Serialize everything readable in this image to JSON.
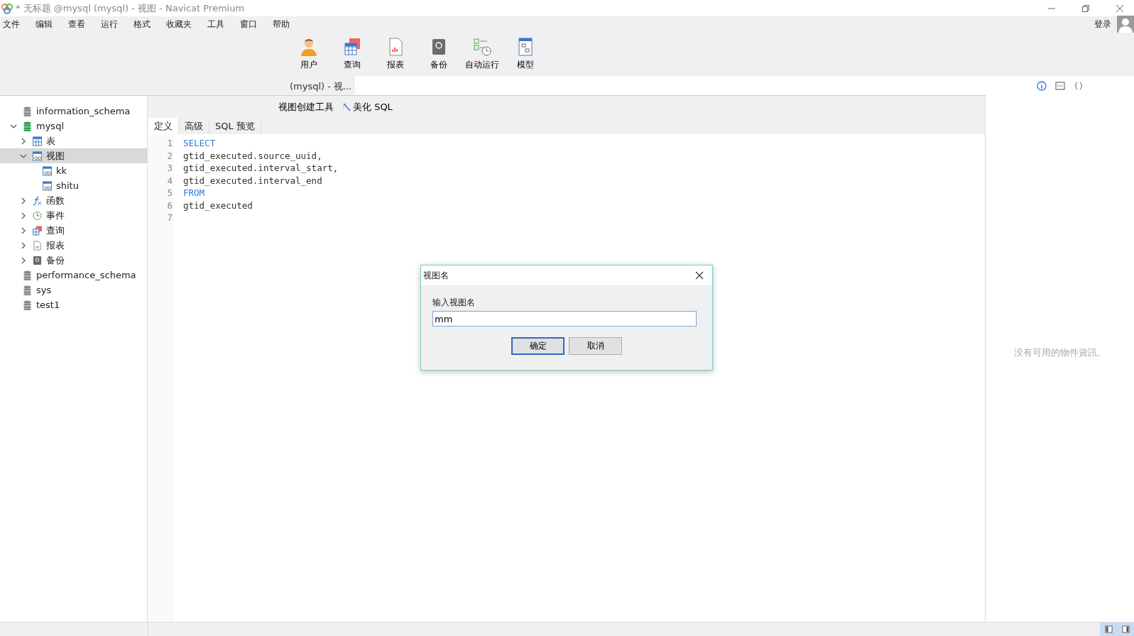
{
  "window": {
    "title": "* 无标题 @mysql (mysql) - 视图 - Navicat Premium"
  },
  "menu": [
    "文件",
    "编辑",
    "查看",
    "运行",
    "格式",
    "收藏夹",
    "工具",
    "窗口",
    "帮助"
  ],
  "account": {
    "label": "登录"
  },
  "toolbar": [
    {
      "kind": "user",
      "label": "用户"
    },
    {
      "kind": "query",
      "label": "查询"
    },
    {
      "kind": "report",
      "label": "报表"
    },
    {
      "kind": "backup",
      "label": "备份"
    },
    {
      "kind": "schedule",
      "label": "自动运行"
    },
    {
      "kind": "model",
      "label": "模型"
    }
  ],
  "document_tab": {
    "label": "(mysql) - 视..."
  },
  "sidebar": {
    "items": [
      {
        "kind": "database",
        "label": "information_schema",
        "selected": false,
        "active": false
      },
      {
        "kind": "database",
        "label": "mysql",
        "expanded": true,
        "selected": false,
        "active": true,
        "children": [
          {
            "kind": "table",
            "label": "表",
            "expanded": false,
            "selected": false
          },
          {
            "kind": "view",
            "label": "视图",
            "expanded": true,
            "selected": true,
            "children": [
              {
                "kind": "view",
                "label": "kk",
                "selected": false
              },
              {
                "kind": "view",
                "label": "shitu",
                "selected": false
              }
            ]
          },
          {
            "kind": "function",
            "label": "函数",
            "expanded": false,
            "selected": false
          },
          {
            "kind": "event",
            "label": "事件",
            "expanded": false,
            "selected": false
          },
          {
            "kind": "query",
            "label": "查询",
            "expanded": false,
            "selected": false
          },
          {
            "kind": "report",
            "label": "报表",
            "expanded": false,
            "selected": false
          },
          {
            "kind": "backup",
            "label": "备份",
            "expanded": false,
            "selected": false
          }
        ]
      },
      {
        "kind": "database",
        "label": "performance_schema",
        "selected": false,
        "active": false
      },
      {
        "kind": "database",
        "label": "sys",
        "selected": false,
        "active": false
      },
      {
        "kind": "database",
        "label": "test1",
        "selected": false,
        "active": false
      }
    ]
  },
  "editor_toolbar": [
    {
      "kind": "builder",
      "label": "视图创建工具"
    },
    {
      "kind": "beautify",
      "label": "美化 SQL"
    }
  ],
  "editor_tabs": [
    {
      "label": "定义",
      "selected": true
    },
    {
      "label": "高级",
      "selected": false
    },
    {
      "label": "SQL 预览",
      "selected": false
    }
  ],
  "code": [
    {
      "number": "1",
      "kind": "keyword",
      "text": "SELECT"
    },
    {
      "number": "2",
      "kind": "plain",
      "text": "gtid_executed.source_uuid,"
    },
    {
      "number": "3",
      "kind": "plain",
      "text": "gtid_executed.interval_start,"
    },
    {
      "number": "4",
      "kind": "plain",
      "text": "gtid_executed.interval_end"
    },
    {
      "number": "5",
      "kind": "keyword",
      "text": "FROM"
    },
    {
      "number": "6",
      "kind": "plain",
      "text": "gtid_executed"
    },
    {
      "number": "7"
    }
  ],
  "info_panel": {
    "message": "没有可用的物件資訊。"
  },
  "dialog": {
    "title": "视图名",
    "label": "输入视图名",
    "value": "mm",
    "buttons": [
      {
        "label": "确定",
        "default": true
      },
      {
        "label": "取消",
        "default": false
      }
    ]
  },
  "status_bar": {
    "toggles": [
      {
        "kind": "left",
        "on": true
      },
      {
        "kind": "right",
        "on": true
      }
    ]
  }
}
